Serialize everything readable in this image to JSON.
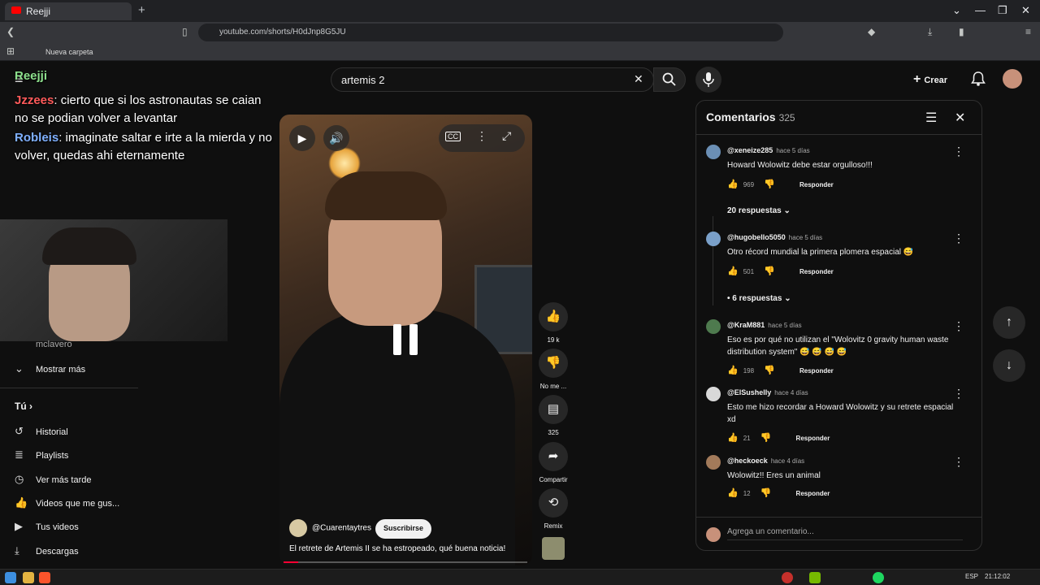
{
  "browser": {
    "tab_title": "Reejji",
    "url": "youtube.com/shorts/H0dJnp8G5JU",
    "bookmark": "Nueva carpeta"
  },
  "header": {
    "search_value": "artemis 2",
    "create_label": "Crear"
  },
  "stream_overlay": {
    "top_name": "Reejji",
    "chat": [
      {
        "user": "Jzzees",
        "text": "cierto que si los astronautas se caian no se podian volver a levantar",
        "user_color": "#ff5a5a"
      },
      {
        "user": "Robleis",
        "text": "imaginate saltar e irte a la mierda y no volver, quedas ahi eternamente",
        "user_color": "#7fb0ff"
      }
    ]
  },
  "sidebar": {
    "more_label": "Mostrar más",
    "partial_label": "mclavero",
    "you_label": "Tú",
    "items": [
      {
        "label": "Historial",
        "icon": "history-icon"
      },
      {
        "label": "Playlists",
        "icon": "playlists-icon"
      },
      {
        "label": "Ver más tarde",
        "icon": "watch-later-icon"
      },
      {
        "label": "Videos que me gus...",
        "icon": "like-icon"
      },
      {
        "label": "Tus videos",
        "icon": "your-videos-icon"
      },
      {
        "label": "Descargas",
        "icon": "download-icon"
      }
    ]
  },
  "video": {
    "channel": "@Cuarentaytres",
    "subscribe_label": "Suscribirse",
    "caption": "El retrete de Artemis II se ha estropeado, qué buena noticia!",
    "progress_fraction": 0.06
  },
  "actions": {
    "likes": "19 k",
    "dislike_label": "No me ...",
    "comments": "325",
    "share_label": "Compartir",
    "remix_label": "Remix"
  },
  "comments_panel": {
    "title": "Comentarios",
    "count": "325",
    "placeholder": "Agrega un comentario...",
    "comments": [
      {
        "author": "@xeneize285",
        "time": "hace 5 días",
        "text": "Howard Wolowitz debe estar orgulloso!!!",
        "likes": "969",
        "replies": "20 respuestas",
        "avatar_color": "#6b8fb5"
      },
      {
        "author": "@hugobello5050",
        "time": "hace 5 días",
        "text": "Otro récord mundial la primera plomera espacial 😅",
        "likes": "501",
        "replies": "• 6 respuestas",
        "avatar_color": "#7aa0c9"
      },
      {
        "author": "@KraM881",
        "time": "hace 5 días",
        "text": "Eso es por qué no utilizan el \"Wolovitz 0 gravity human waste distribution system\" 😅 😅 😅 😅",
        "likes": "198",
        "replies": "",
        "avatar_color": "#4e7a4e"
      },
      {
        "author": "@ElSushelly",
        "time": "hace 4 días",
        "text": "Esto me hizo recordar a Howard Wolowitz y su retrete espacial xd",
        "likes": "21",
        "replies": "",
        "avatar_color": "#d9d9d9"
      },
      {
        "author": "@heckoeck",
        "time": "hace 4 días",
        "text": "Wolowitz!! Eres un animal",
        "likes": "12",
        "replies": "",
        "avatar_color": "#a27a5a"
      }
    ],
    "reply_label": "Responder"
  },
  "taskbar": {
    "lang": "ESP",
    "time": "21:12:02"
  }
}
